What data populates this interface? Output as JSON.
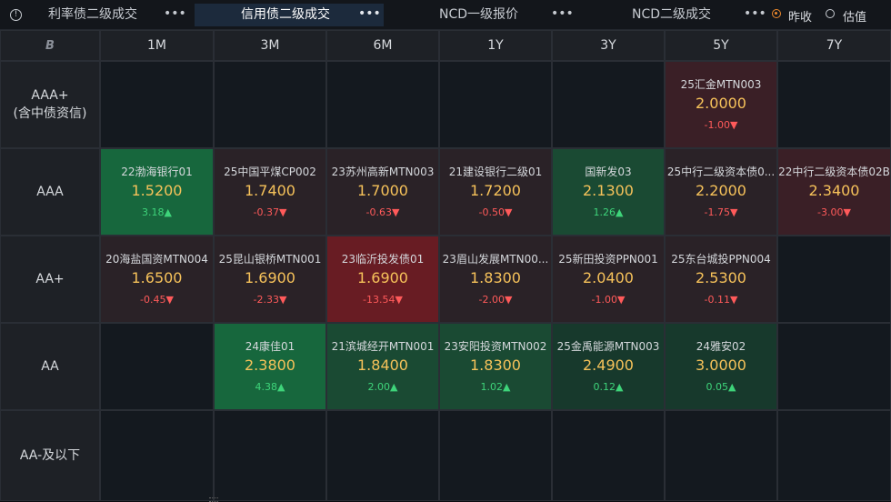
{
  "tabs": [
    {
      "label": "利率债二级成交",
      "more": "•••",
      "active": false
    },
    {
      "label": "信用债二级成交",
      "more": "•••",
      "active": true
    },
    {
      "label": "NCD一级报价",
      "more": "•••",
      "active": false
    },
    {
      "label": "NCD二级成交",
      "more": "•••",
      "active": false
    }
  ],
  "info_icon": "info-circle-icon",
  "radios": [
    {
      "label": "昨收",
      "selected": true
    },
    {
      "label": "估值",
      "selected": false
    }
  ],
  "colors": {
    "accent": "#f08a2c",
    "rate": "#f6c25a",
    "up": "#3ed47a",
    "down": "#ff5a5a"
  },
  "grid": {
    "corner_icon": "B",
    "columns": [
      "1M",
      "3M",
      "6M",
      "1Y",
      "3Y",
      "5Y",
      "7Y"
    ],
    "rows": [
      {
        "label_lines": [
          "AAA+",
          "(含中债资信)"
        ],
        "cells": [
          null,
          null,
          null,
          null,
          null,
          {
            "name": "25汇金MTN003",
            "rate": "2.0000",
            "change": "-1.00▼",
            "dir": "down",
            "level": "r2"
          },
          null
        ]
      },
      {
        "label_lines": [
          "AAA"
        ],
        "cells": [
          {
            "name": "22渤海银行01",
            "rate": "1.5200",
            "change": "3.18▲",
            "dir": "up",
            "level": "g3"
          },
          {
            "name": "25中国平煤CP002",
            "rate": "1.7400",
            "change": "-0.37▼",
            "dir": "down",
            "level": "r1"
          },
          {
            "name": "23苏州高新MTN003",
            "rate": "1.7000",
            "change": "-0.63▼",
            "dir": "down",
            "level": "r1"
          },
          {
            "name": "21建设银行二级01",
            "rate": "1.7200",
            "change": "-0.50▼",
            "dir": "down",
            "level": "r1"
          },
          {
            "name": "国新发03",
            "rate": "2.1300",
            "change": "1.26▲",
            "dir": "up",
            "level": "g2"
          },
          {
            "name": "25中行二级资本债0...",
            "rate": "2.2000",
            "change": "-1.75▼",
            "dir": "down",
            "level": "r1"
          },
          {
            "name": "22中行二级资本债02B",
            "rate": "2.3400",
            "change": "-3.00▼",
            "dir": "down",
            "level": "r2"
          }
        ]
      },
      {
        "label_lines": [
          "AA+"
        ],
        "cells": [
          {
            "name": "20海盐国资MTN004",
            "rate": "1.6500",
            "change": "-0.45▼",
            "dir": "down",
            "level": "r1"
          },
          {
            "name": "25昆山银桥MTN001",
            "rate": "1.6900",
            "change": "-2.33▼",
            "dir": "down",
            "level": "r1"
          },
          {
            "name": "23临沂投发债01",
            "rate": "1.6900",
            "change": "-13.54▼",
            "dir": "down",
            "level": "r3"
          },
          {
            "name": "23眉山发展MTN00...",
            "rate": "1.8300",
            "change": "-2.00▼",
            "dir": "down",
            "level": "r1"
          },
          {
            "name": "25新田投资PPN001",
            "rate": "2.0400",
            "change": "-1.00▼",
            "dir": "down",
            "level": "r1"
          },
          {
            "name": "25东台城投PPN004",
            "rate": "2.5300",
            "change": "-0.11▼",
            "dir": "down",
            "level": "r1"
          },
          null
        ]
      },
      {
        "label_lines": [
          "AA"
        ],
        "cells": [
          null,
          {
            "name": "24康佳01",
            "rate": "2.3800",
            "change": "4.38▲",
            "dir": "up",
            "level": "g3"
          },
          {
            "name": "21滨城经开MTN001",
            "rate": "1.8400",
            "change": "2.00▲",
            "dir": "up",
            "level": "g2"
          },
          {
            "name": "23安阳投资MTN002",
            "rate": "1.8300",
            "change": "1.02▲",
            "dir": "up",
            "level": "g2"
          },
          {
            "name": "25金禹能源MTN003",
            "rate": "2.4900",
            "change": "0.12▲",
            "dir": "up",
            "level": "g1"
          },
          {
            "name": "24雅安02",
            "rate": "3.0000",
            "change": "0.05▲",
            "dir": "up",
            "level": "g1"
          },
          null
        ]
      },
      {
        "label_lines": [
          "AA-及以下"
        ],
        "cells": [
          null,
          null,
          null,
          null,
          null,
          null,
          null
        ]
      }
    ]
  }
}
